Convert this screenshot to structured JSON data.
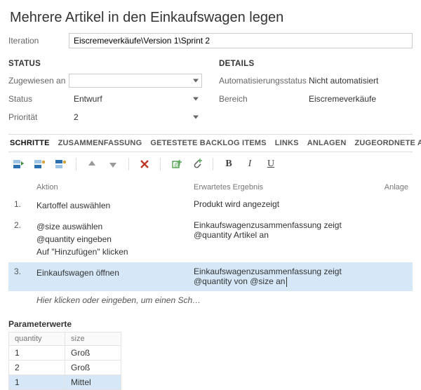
{
  "title": "Mehrere Artikel in den Einkaufswagen legen",
  "iteration": {
    "label": "Iteration",
    "value": "Eiscremeverkäufe\\Version 1\\Sprint 2"
  },
  "status_section": {
    "heading": "STATUS",
    "assigned": {
      "label": "Zugewiesen an",
      "value": ""
    },
    "state": {
      "label": "Status",
      "value": "Entwurf"
    },
    "priority": {
      "label": "Priorität",
      "value": "2"
    }
  },
  "details_section": {
    "heading": "DETAILS",
    "automation": {
      "label": "Automatisierungsstatus",
      "value": "Nicht automatisiert"
    },
    "area": {
      "label": "Bereich",
      "value": "Eiscremeverkäufe"
    }
  },
  "tabs": [
    "SCHRITTE",
    "ZUSAMMENFASSUNG",
    "GETESTETE BACKLOG ITEMS",
    "LINKS",
    "ANLAGEN",
    "ZUGEORDNETE AUTOMATISIERUNG"
  ],
  "active_tab_index": 0,
  "steps": {
    "columns": {
      "action": "Aktion",
      "expected": "Erwartetes Ergebnis",
      "attachment": "Anlage"
    },
    "rows": [
      {
        "num": "1.",
        "action": [
          "Kartoffel auswählen"
        ],
        "expected": "Produkt wird angezeigt"
      },
      {
        "num": "2.",
        "action": [
          "@size auswählen",
          "@quantity eingeben",
          "Auf \"Hinzufügen\" klicken"
        ],
        "expected": "Einkaufswagenzusammenfassung zeigt @quantity Artikel an"
      },
      {
        "num": "3.",
        "action": [
          "Einkaufswagen öffnen"
        ],
        "expected": "Einkaufswagenzusammenfassung zeigt @quantity von @size an",
        "selected": true
      }
    ],
    "placeholder": "Hier klicken oder eingeben, um einen Sch…"
  },
  "parameters": {
    "heading": "Parameterwerte",
    "columns": [
      "quantity",
      "size"
    ],
    "rows": [
      {
        "values": [
          "1",
          "Groß"
        ]
      },
      {
        "values": [
          "2",
          "Groß"
        ]
      },
      {
        "values": [
          "1",
          "Mittel"
        ],
        "selected": true
      }
    ]
  }
}
